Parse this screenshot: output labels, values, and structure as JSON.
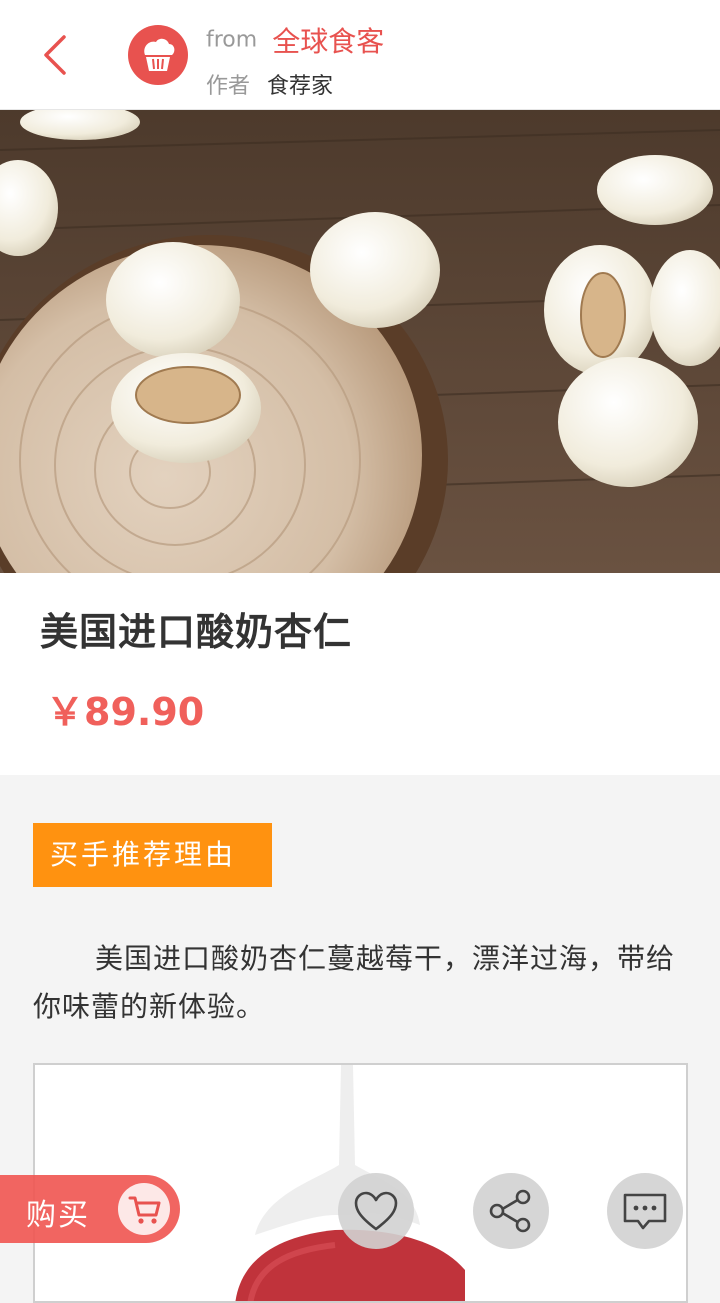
{
  "header": {
    "from_label": "from",
    "from_source": "全球食客",
    "author_label": "作者",
    "author_name": "食荐家"
  },
  "product": {
    "title": "美国进口酸奶杏仁",
    "price": "￥89.90"
  },
  "recommendation": {
    "badge": "买手推荐理由",
    "text": "美国进口酸奶杏仁蔓越莓干，漂洋过海，带给你味蕾的新体验。"
  },
  "actions": {
    "buy_label": "购买",
    "icons": [
      "cart-icon",
      "heart-icon",
      "share-icon",
      "comment-icon"
    ]
  },
  "colors": {
    "brand_red": "#e8524f",
    "price_red": "#f0605b",
    "badge_orange": "#ff9210"
  }
}
